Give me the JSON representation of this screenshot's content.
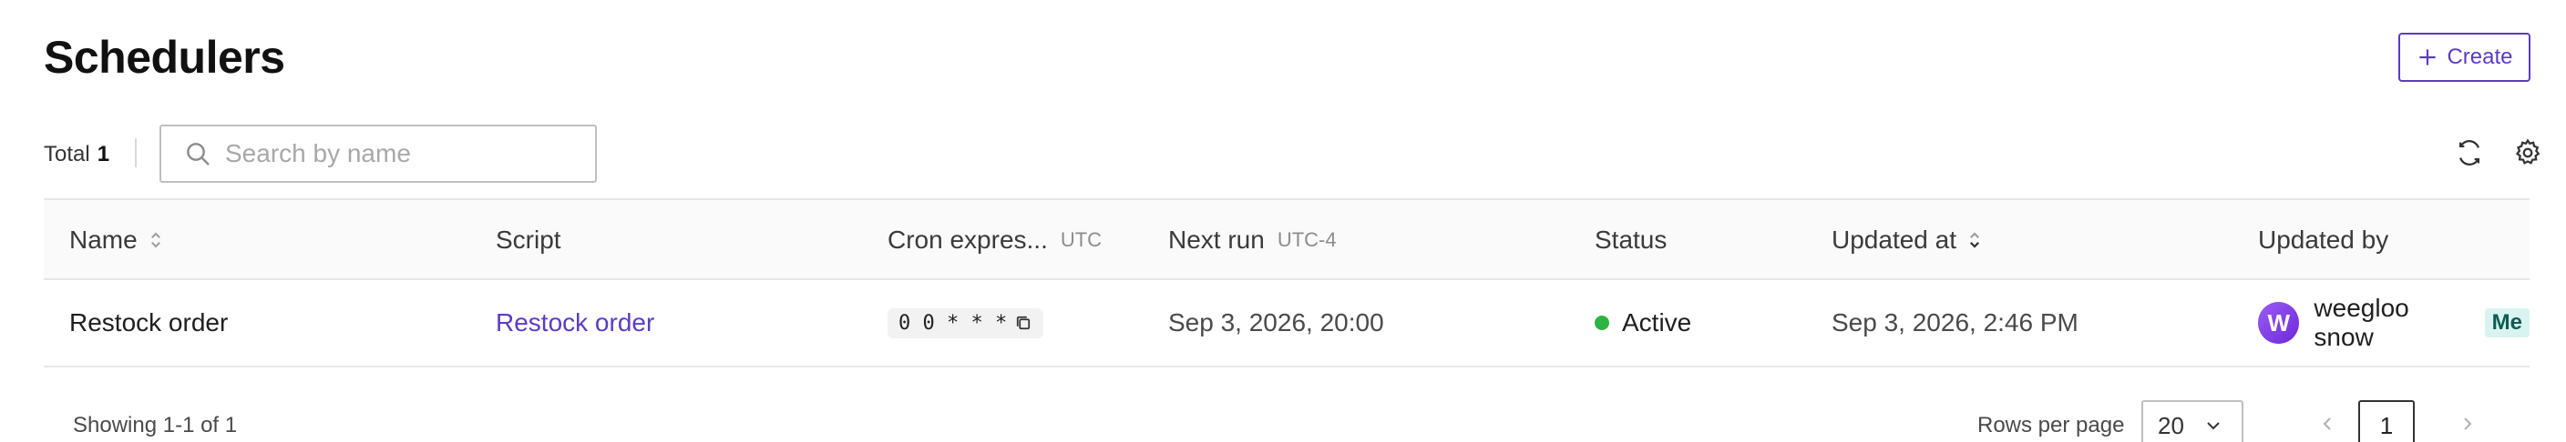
{
  "header": {
    "title": "Schedulers",
    "create_label": "Create"
  },
  "toolbar": {
    "total_label": "Total",
    "total_count": "1",
    "search_placeholder": "Search by name"
  },
  "table": {
    "columns": {
      "name": "Name",
      "script": "Script",
      "cron": "Cron expres...",
      "cron_tz": "UTC",
      "next_run": "Next run",
      "next_run_tz": "UTC-4",
      "status": "Status",
      "updated_at": "Updated at",
      "updated_by": "Updated by"
    },
    "rows": [
      {
        "name": "Restock order",
        "script": "Restock order",
        "cron": "0 0 * * *",
        "next_run": "Sep 3, 2026, 20:00",
        "status": "Active",
        "updated_at": "Sep 3, 2026, 2:46 PM",
        "updated_by": "weegloo snow",
        "avatar_letter": "W",
        "me_badge": "Me"
      }
    ]
  },
  "footer": {
    "showing": "Showing 1-1 of 1",
    "rows_per_page_label": "Rows per page",
    "rows_per_page_value": "20",
    "current_page": "1"
  },
  "colors": {
    "accent": "#5b3cc4",
    "status_active": "#2fb344",
    "me_badge_bg": "#d9f3f0"
  },
  "icons": [
    "plus-icon",
    "search-icon",
    "refresh-icon",
    "gear-icon",
    "sort-icon",
    "sort-desc-icon",
    "copy-icon",
    "chevron-down-icon",
    "chevron-left-icon",
    "chevron-right-icon"
  ]
}
